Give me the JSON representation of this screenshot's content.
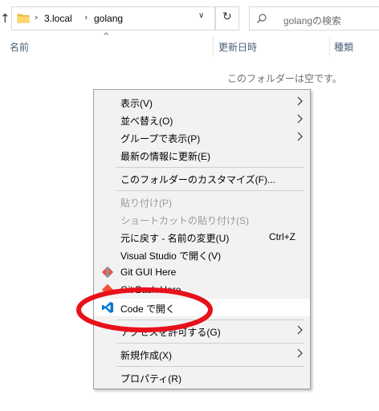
{
  "address": {
    "crumbs": [
      "3.local",
      "golang"
    ],
    "sep_glyph": "›"
  },
  "search": {
    "placeholder": "golangの検索"
  },
  "columns": {
    "name": "名前",
    "modified": "更新日時",
    "type": "種類"
  },
  "empty_message": "このフォルダーは空です。",
  "menu": {
    "view": "表示(V)",
    "sort": "並べ替え(O)",
    "group": "グループで表示(P)",
    "refresh": "最新の情報に更新(E)",
    "customize": "このフォルダーのカスタマイズ(F)...",
    "paste": "貼り付け(P)",
    "paste_shortcut": "ショートカットの貼り付け(S)",
    "undo": "元に戻す - 名前の変更(U)",
    "undo_shortcut": "Ctrl+Z",
    "vs_open": "Visual Studio で開く(V)",
    "git_gui": "Git GUI Here",
    "git_bash": "Git Bash Here",
    "code_open": "Code で開く",
    "access": "アクセスを許可する(G)",
    "new": "新規作成(X)",
    "properties": "プロパティ(R)"
  },
  "colors": {
    "annotation_red": "#e8101a",
    "vscode_blue": "#0078d4",
    "folder_yellow": "#f4c542"
  },
  "icons": [
    "up-arrow-icon",
    "folder-icon",
    "refresh-icon",
    "search-icon",
    "git-icon",
    "vscode-icon",
    "chevron-right-icon"
  ]
}
